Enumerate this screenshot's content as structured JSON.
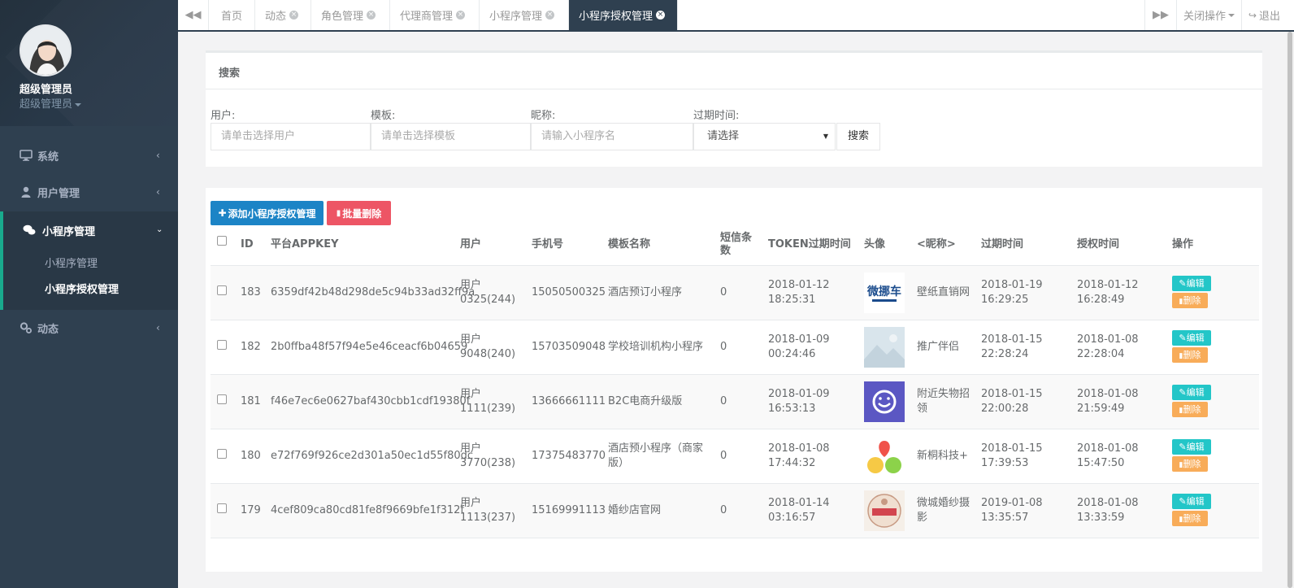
{
  "profile": {
    "name": "超级管理员",
    "role": "超级管理员"
  },
  "nav": {
    "items": [
      {
        "label": "系统",
        "icon": "monitor-icon"
      },
      {
        "label": "用户管理",
        "icon": "user-icon"
      },
      {
        "label": "小程序管理",
        "icon": "chat-icon"
      },
      {
        "label": "动态",
        "icon": "gears-icon"
      }
    ],
    "sub": [
      "小程序管理",
      "小程序授权管理"
    ]
  },
  "tabs": {
    "items": [
      {
        "label": "首页"
      },
      {
        "label": "动态"
      },
      {
        "label": "角色管理"
      },
      {
        "label": "代理商管理"
      },
      {
        "label": "小程序管理"
      },
      {
        "label": "小程序授权管理"
      }
    ],
    "close_ops": "关闭操作",
    "logout": "退出"
  },
  "search": {
    "title": "搜索",
    "user_label": "用户:",
    "user_placeholder": "请单击选择用户",
    "template_label": "模板:",
    "template_placeholder": "请单击选择模板",
    "nickname_label": "昵称:",
    "nickname_placeholder": "请输入小程序名",
    "expire_label": "过期时间:",
    "expire_value": "请选择",
    "button": "搜索"
  },
  "actions": {
    "add": "添加小程序授权管理",
    "batch_delete": "批量删除"
  },
  "table": {
    "headers": {
      "id": "ID",
      "appkey": "平台APPKEY",
      "user": "用户",
      "phone": "手机号",
      "template": "模板名称",
      "sms": "短信条数",
      "token": "TOKEN过期时间",
      "avatar": "头像",
      "nickname": "<昵称>",
      "expire": "过期时间",
      "auth": "授权时间",
      "ops": "操作"
    },
    "edit_label": "编辑",
    "delete_label": "删除",
    "rows": [
      {
        "id": "183",
        "appkey": "6359df42b48d298de5c94b33ad32ff9a",
        "user1": "用户",
        "user2": "0325(244)",
        "phone": "15050500325",
        "template": "酒店预订小程序",
        "sms": "0",
        "token1": "2018-01-12",
        "token2": "18:25:31",
        "avatar": "car-logo",
        "nick": "壁纸直销网",
        "exp1": "2018-01-19",
        "exp2": "16:29:25",
        "auth1": "2018-01-12",
        "auth2": "16:28:49"
      },
      {
        "id": "182",
        "appkey": "2b0ffba48f57f94e5e46ceacf6b04659",
        "user1": "用户",
        "user2": "9048(240)",
        "phone": "15703509048",
        "template": "学校培训机构小程序",
        "sms": "0",
        "token1": "2018-01-09",
        "token2": "00:24:46",
        "avatar": "placeholder-image",
        "nick": "推广伴侣",
        "exp1": "2018-01-15",
        "exp2": "22:28:24",
        "auth1": "2018-01-08",
        "auth2": "22:28:04"
      },
      {
        "id": "181",
        "appkey": "f46e7ec6e0627baf430cbb1cdf19380f",
        "user1": "用户",
        "user2": "1111(239)",
        "phone": "13666661111",
        "template": "B2C电商升级版",
        "sms": "0",
        "token1": "2018-01-09",
        "token2": "16:53:13",
        "avatar": "smile-logo",
        "nick": "附近失物招领",
        "exp1": "2018-01-15",
        "exp2": "22:00:28",
        "auth1": "2018-01-08",
        "auth2": "21:59:49"
      },
      {
        "id": "180",
        "appkey": "e72f769f926ce2d301a50ec1d55f80dc",
        "user1": "用户",
        "user2": "3770(238)",
        "phone": "17375483770",
        "template": "酒店预小程序（商家版）",
        "sms": "0",
        "token1": "2018-01-08",
        "token2": "17:44:32",
        "avatar": "triple-dot-logo",
        "nick": "新桐科技+",
        "exp1": "2018-01-15",
        "exp2": "17:39:53",
        "auth1": "2018-01-08",
        "auth2": "15:47:50"
      },
      {
        "id": "179",
        "appkey": "4cef809ca80cd81fe8f9669bfe1f312f",
        "user1": "用户",
        "user2": "1113(237)",
        "phone": "15169991113",
        "template": "婚纱店官网",
        "sms": "0",
        "token1": "2018-01-14",
        "token2": "03:16:57",
        "avatar": "wedding-logo",
        "nick": "微城婚纱摄影",
        "exp1": "2019-01-08",
        "exp2": "13:35:57",
        "auth1": "2018-01-08",
        "auth2": "13:33:59"
      }
    ]
  },
  "colors": {
    "sidebar": "#2f4050",
    "accent": "#19aa8d",
    "primary": "#1c84c6",
    "danger": "#ed5565",
    "info": "#23c6c8",
    "warning": "#f8ac59"
  }
}
